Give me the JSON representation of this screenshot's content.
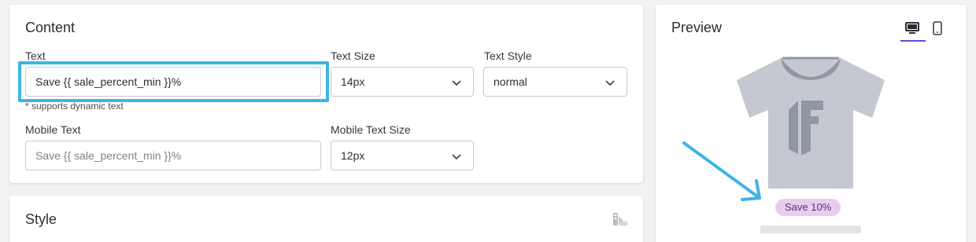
{
  "content": {
    "title": "Content",
    "text_label": "Text",
    "text_value": "Save {{ sale_percent_min }}%",
    "text_hint": "* supports dynamic text",
    "text_size_label": "Text Size",
    "text_size_value": "14px",
    "text_style_label": "Text Style",
    "text_style_value": "normal",
    "mobile_text_label": "Mobile Text",
    "mobile_text_placeholder": "Save {{ sale_percent_min }}%",
    "mobile_text_size_label": "Mobile Text Size",
    "mobile_text_size_value": "12px"
  },
  "style": {
    "title": "Style",
    "icon": "paint-icon"
  },
  "preview": {
    "title": "Preview",
    "desktop_icon": "desktop-icon",
    "mobile_icon": "mobile-icon",
    "badge_text": "Save 10%",
    "product_icon": "tshirt-icon"
  },
  "colors": {
    "highlight": "#3db4e5",
    "badge_bg": "#ecc9f2",
    "active_tab_underline": "#5a4fcf"
  }
}
